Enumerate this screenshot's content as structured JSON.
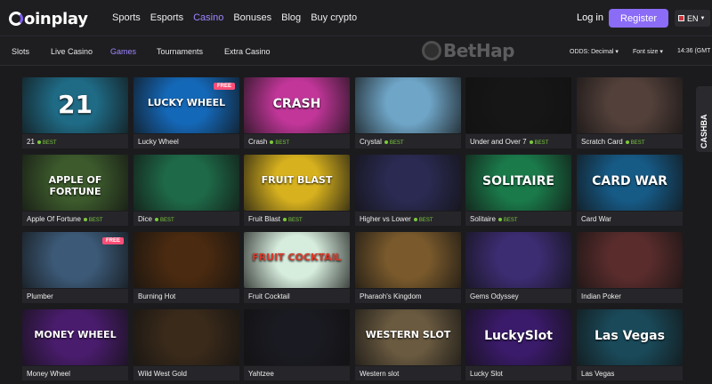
{
  "brand": {
    "logo_text": "oinplay"
  },
  "header": {
    "nav": [
      "Sports",
      "Esports",
      "Casino",
      "Bonuses",
      "Blog",
      "Buy crypto"
    ],
    "active_nav": "Casino",
    "login": "Log in",
    "register": "Register",
    "language": "EN"
  },
  "subnav": {
    "items": [
      "Slots",
      "Live Casino",
      "Games",
      "Tournaments",
      "Extra Casino"
    ],
    "active": "Games",
    "odds": "ODDS: Decimal",
    "font_size": "Font size",
    "time": "14:36 (GMT"
  },
  "watermark": "BetHap",
  "cashback": "CASHBA",
  "best_label": "BEST",
  "free_label": "FREE",
  "games": [
    {
      "name": "21",
      "best": true,
      "free": false,
      "art": "21",
      "color": "#1f6b86"
    },
    {
      "name": "Lucky Wheel",
      "best": false,
      "free": true,
      "art": "LUCKY WHEEL",
      "color": "#1468b8"
    },
    {
      "name": "Crash",
      "best": true,
      "free": false,
      "art": "CRASH",
      "color": "#c2369a"
    },
    {
      "name": "Crystal",
      "best": true,
      "free": false,
      "art": "",
      "color": "#6fa6c8"
    },
    {
      "name": "Under and Over 7",
      "best": true,
      "free": false,
      "art": "",
      "color": "#161616"
    },
    {
      "name": "Scratch Card",
      "best": true,
      "free": false,
      "art": "",
      "color": "#53403a"
    },
    {
      "name": "Apple Of Fortune",
      "best": true,
      "free": false,
      "art": "APPLE OF FORTUNE",
      "color": "#3c5a2c"
    },
    {
      "name": "Dice",
      "best": true,
      "free": false,
      "art": "",
      "color": "#1e6a48"
    },
    {
      "name": "Fruit Blast",
      "best": true,
      "free": false,
      "art": "FRUIT BLAST",
      "color": "#d8b21e"
    },
    {
      "name": "Higher vs Lower",
      "best": true,
      "free": false,
      "art": "",
      "color": "#2a2a52"
    },
    {
      "name": "Solitaire",
      "best": true,
      "free": false,
      "art": "SOLITAIRE",
      "color": "#1a7a4a"
    },
    {
      "name": "Card War",
      "best": false,
      "free": false,
      "art": "CARD WAR",
      "color": "#165a86"
    },
    {
      "name": "Plumber",
      "best": false,
      "free": true,
      "art": "",
      "color": "#3c5a78"
    },
    {
      "name": "Burning Hot",
      "best": false,
      "free": false,
      "art": "",
      "color": "#4a2a10"
    },
    {
      "name": "Fruit Cocktail",
      "best": false,
      "free": false,
      "art": "FRUIT COCKTAIL",
      "color": "#d6ecdc"
    },
    {
      "name": "Pharaoh's Kingdom",
      "best": false,
      "free": false,
      "art": "",
      "color": "#7a5a2c"
    },
    {
      "name": "Gems Odyssey",
      "best": false,
      "free": false,
      "art": "",
      "color": "#3c2c72"
    },
    {
      "name": "Indian Poker",
      "best": false,
      "free": false,
      "art": "",
      "color": "#5a2c2c"
    },
    {
      "name": "Money Wheel",
      "best": false,
      "free": false,
      "art": "MONEY WHEEL",
      "color": "#4a1c6e"
    },
    {
      "name": "Wild West Gold",
      "best": false,
      "free": false,
      "art": "",
      "color": "#3a2a1a"
    },
    {
      "name": "Yahtzee",
      "best": false,
      "free": false,
      "art": "",
      "color": "#1a1a22"
    },
    {
      "name": "Western slot",
      "best": false,
      "free": false,
      "art": "WESTERN SLOT",
      "color": "#6a5a40"
    },
    {
      "name": "Lucky Slot",
      "best": false,
      "free": false,
      "art": "LuckySlot",
      "color": "#3a1a6a"
    },
    {
      "name": "Las Vegas",
      "best": false,
      "free": false,
      "art": "Las Vegas",
      "color": "#1a4a5a"
    }
  ]
}
